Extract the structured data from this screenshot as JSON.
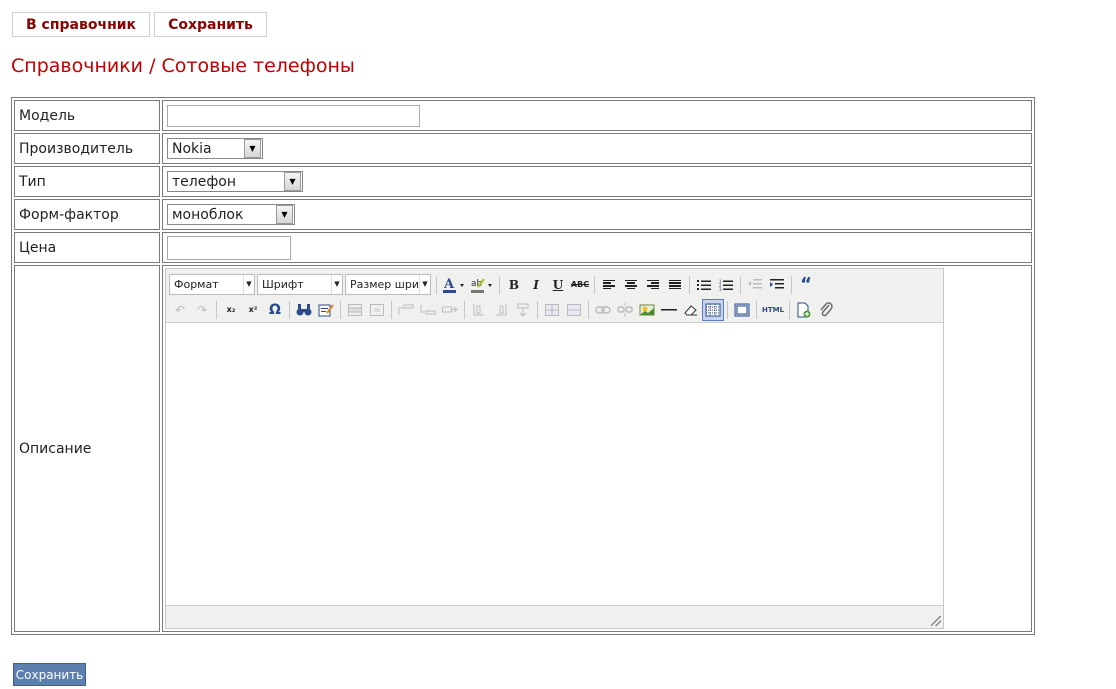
{
  "top_buttons": {
    "to_directory": "В справочник",
    "save": "Сохранить"
  },
  "page_title": "Справочники / Сотовые телефоны",
  "form": {
    "model": {
      "label": "Модель",
      "value": ""
    },
    "manufacturer": {
      "label": "Производитель",
      "value": "Nokia"
    },
    "type": {
      "label": "Тип",
      "value": "телефон"
    },
    "form_factor": {
      "label": "Форм-фактор",
      "value": "моноблок"
    },
    "price": {
      "label": "Цена",
      "value": ""
    },
    "description": {
      "label": "Описание"
    }
  },
  "editor": {
    "format_select": "Формат",
    "font_select": "Шрифт",
    "size_select": "Размер шрифта",
    "icons": {
      "bold": "B",
      "italic": "I",
      "underline": "U",
      "strike": "ABC",
      "subscript": "x₂",
      "superscript": "x²",
      "omega": "Ω",
      "html": "HTML",
      "quote": "“"
    }
  },
  "bottom_button": "Сохранить"
}
